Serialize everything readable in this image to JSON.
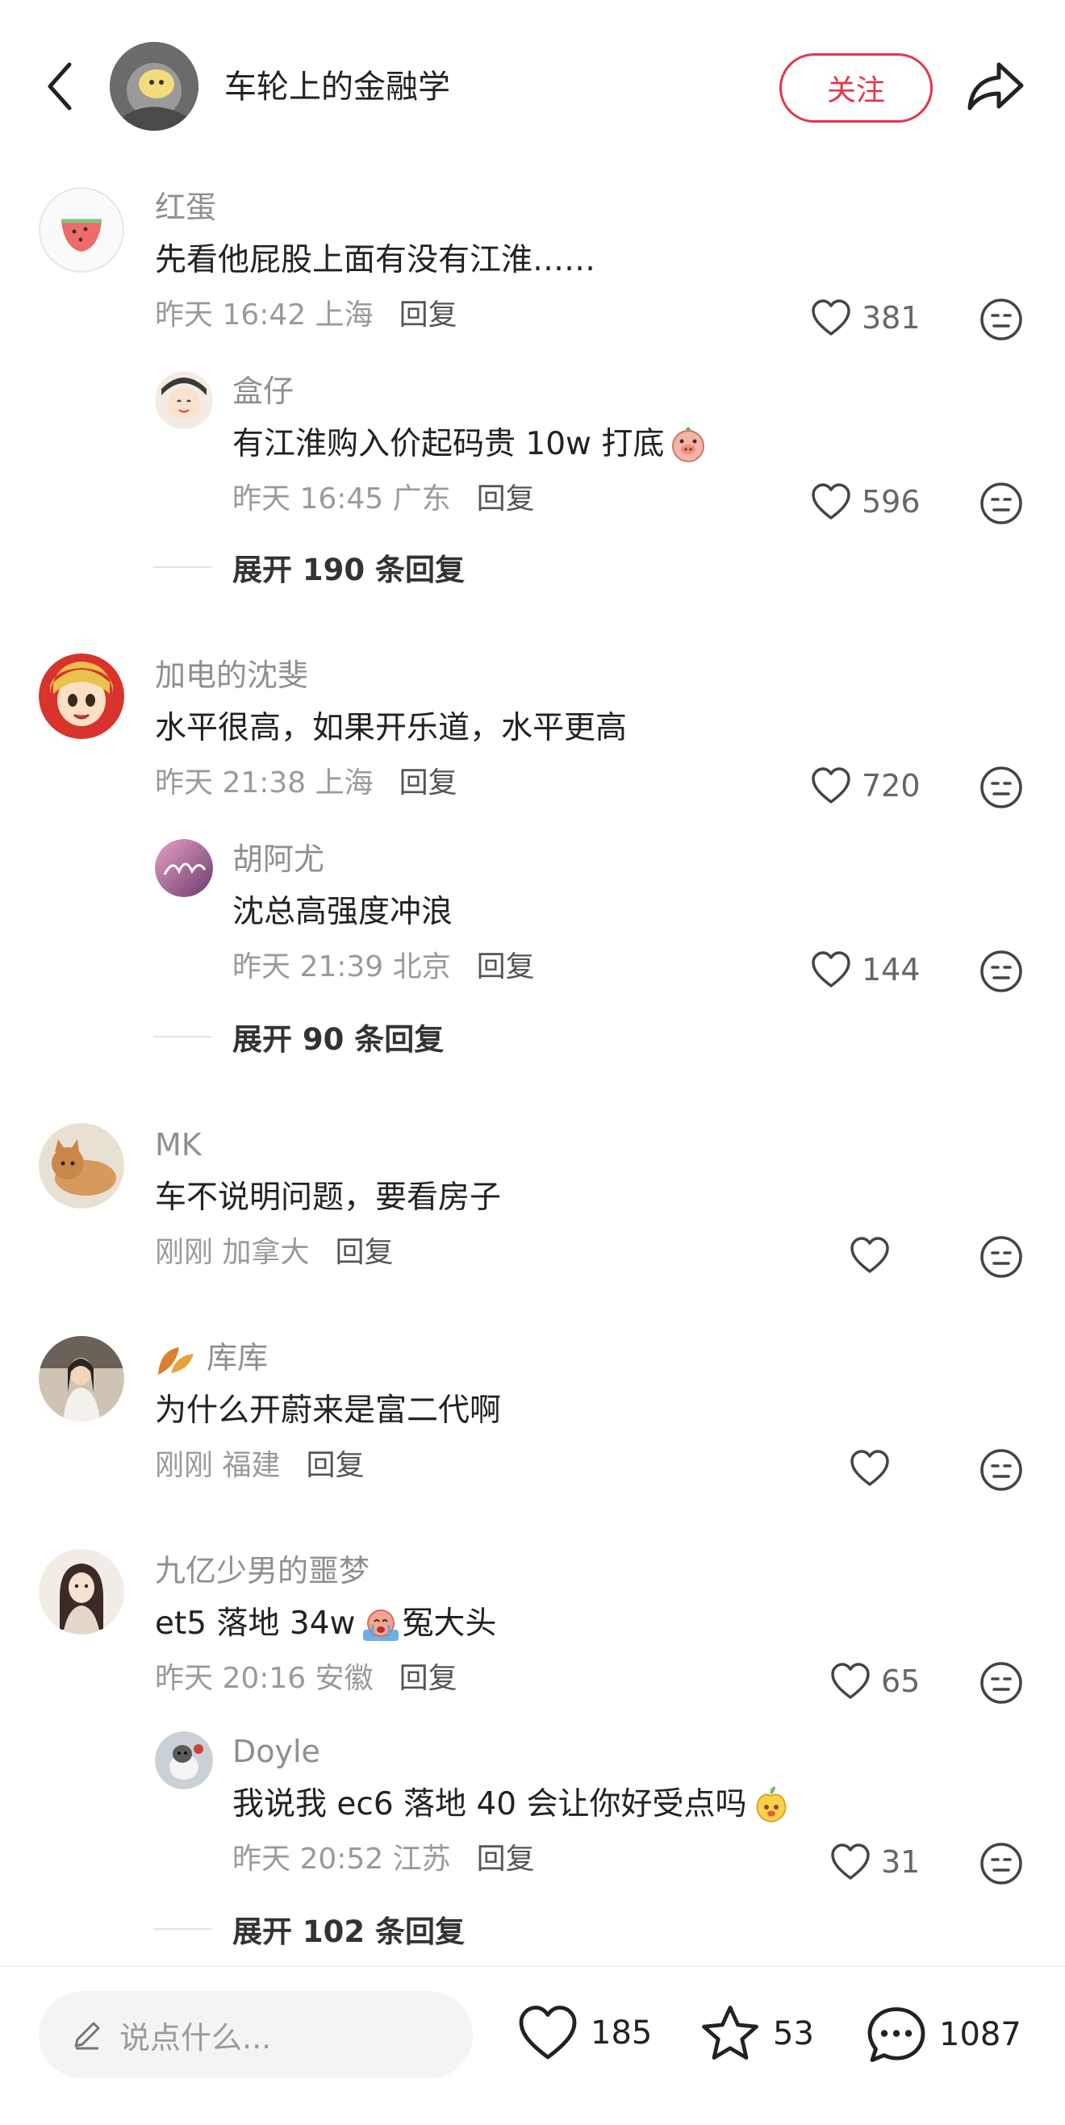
{
  "header": {
    "account_name": "车轮上的金融学",
    "follow_label": "关注"
  },
  "comments": [
    {
      "user": "红蛋",
      "text": "先看他屁股上面有没有江淮……",
      "time": "昨天 16:42 上海",
      "reply_label": "回复",
      "likes": "381",
      "reply": {
        "user": "盒仔",
        "text": "有江淮购入价起码贵 10w 打底",
        "time": "昨天 16:45 广东",
        "reply_label": "回复",
        "likes": "596"
      },
      "expand": "展开 190 条回复"
    },
    {
      "user": "加电的沈斐",
      "text": "水平很高，如果开乐道，水平更高",
      "time": "昨天 21:38 上海",
      "reply_label": "回复",
      "likes": "720",
      "reply": {
        "user": "胡阿尤",
        "text": "沈总高强度冲浪",
        "time": "昨天 21:39 北京",
        "reply_label": "回复",
        "likes": "144"
      },
      "expand": "展开 90 条回复"
    },
    {
      "user": "MK",
      "text": "车不说明问题，要看房子",
      "time": "刚刚 加拿大",
      "reply_label": "回复",
      "likes": ""
    },
    {
      "user": "库库",
      "text": "为什么开蔚来是富二代啊",
      "time": "刚刚 福建",
      "reply_label": "回复",
      "likes": ""
    },
    {
      "user": "九亿少男的噩梦",
      "text_a": "et5 落地 34w",
      "text_b": " 冤大头",
      "time": "昨天 20:16 安徽",
      "reply_label": "回复",
      "likes": "65",
      "reply": {
        "user": "Doyle",
        "text": "我说我 ec6 落地 40 会让你好受点吗",
        "time": "昨天 20:52 江苏",
        "reply_label": "回复",
        "likes": "31"
      },
      "expand": "展开 102 条回复"
    }
  ],
  "bottom_bar": {
    "input_placeholder": "说点什么...",
    "likes": "185",
    "stars": "53",
    "comments": "1087"
  }
}
